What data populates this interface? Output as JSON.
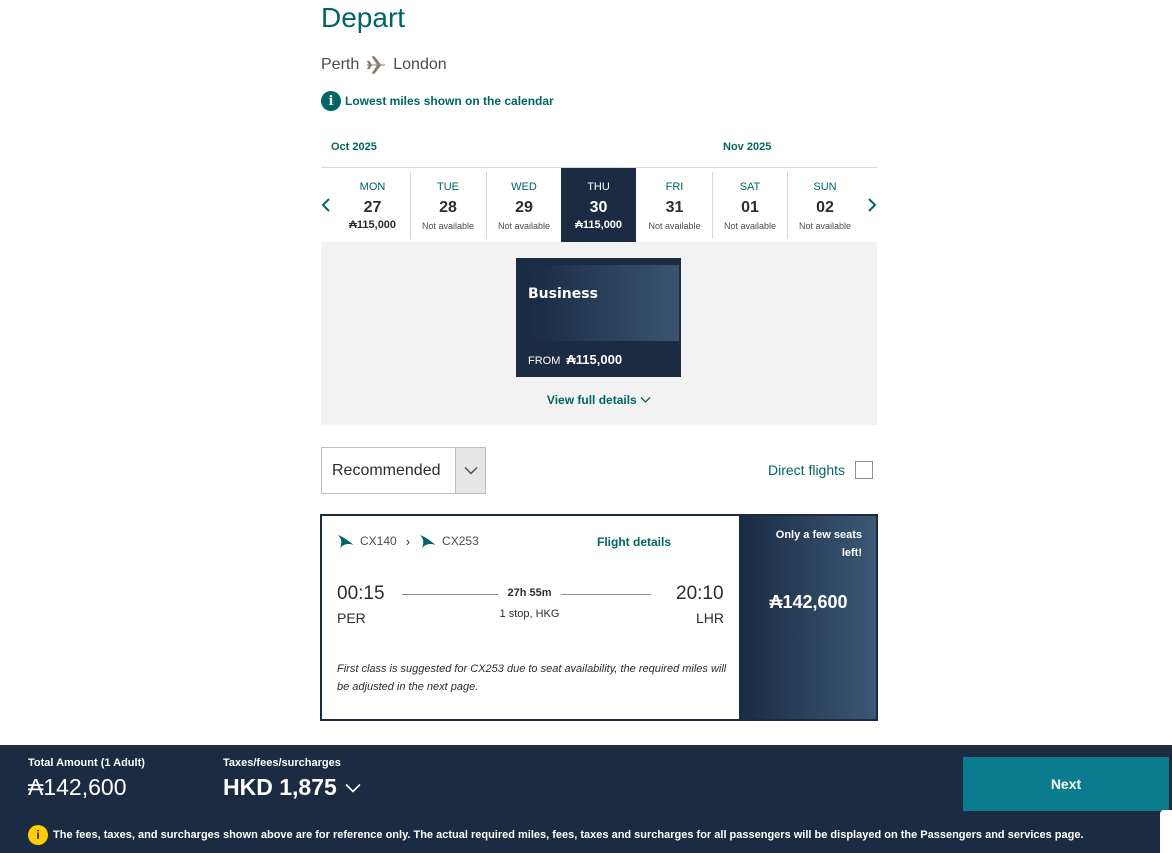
{
  "header": {
    "title": "Depart",
    "origin": "Perth",
    "destination": "London"
  },
  "info_note": "Lowest miles shown on the calendar",
  "calendar": {
    "months": [
      "Oct 2025",
      "Nov 2025"
    ],
    "days": [
      {
        "dow": "MON",
        "date": "27",
        "price": "115,000",
        "status": ""
      },
      {
        "dow": "TUE",
        "date": "28",
        "price": "",
        "status": "Not available"
      },
      {
        "dow": "WED",
        "date": "29",
        "price": "",
        "status": "Not available"
      },
      {
        "dow": "THU",
        "date": "30",
        "price": "115,000",
        "status": "",
        "selected": true
      },
      {
        "dow": "FRI",
        "date": "31",
        "price": "",
        "status": "Not available"
      },
      {
        "dow": "SAT",
        "date": "01",
        "price": "",
        "status": "Not available"
      },
      {
        "dow": "SUN",
        "date": "02",
        "price": "",
        "status": "Not available"
      }
    ]
  },
  "cabin": {
    "name": "Business",
    "from_label": "FROM",
    "from_price": "115,000",
    "view_details": "View full details"
  },
  "filters": {
    "sort_value": "Recommended",
    "direct_label": "Direct flights",
    "direct_checked": false
  },
  "flight": {
    "codes": [
      "CX140",
      "CX253"
    ],
    "details_link": "Flight details",
    "depart_time": "00:15",
    "depart_airport": "PER",
    "arrive_time": "20:10",
    "arrive_airport": "LHR",
    "duration": "27h 55m",
    "stops": "1 stop, HKG",
    "note": "First class is suggested for CX253 due to seat availability, the required miles will be adjusted in the next page.",
    "seats_warning": "Only a few seats left!",
    "price": "142,600"
  },
  "footer": {
    "total_label": "Total Amount (1 Adult)",
    "total_value": "142,600",
    "tax_label": "Taxes/fees/surcharges",
    "tax_value": "HKD 1,875",
    "next_label": "Next",
    "disclaimer": "The fees, taxes, and surcharges shown above are for reference only. The actual required miles, fees, taxes and surcharges for all passengers will be displayed on the Passengers and services page."
  },
  "colors": {
    "brand_teal": "#006564",
    "navy": "#1a2b42",
    "button": "#0b7c8d",
    "warning": "#ffcd00"
  }
}
